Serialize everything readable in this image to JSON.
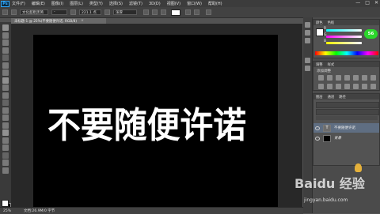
{
  "app": {
    "logo": "Ps"
  },
  "menu": {
    "items": [
      "文件(F)",
      "编辑(E)",
      "图像(I)",
      "图层(L)",
      "类型(Y)",
      "选择(S)",
      "滤镜(T)",
      "3D(D)",
      "视图(V)",
      "窗口(W)",
      "帮助(H)"
    ],
    "window_controls": [
      "—",
      "□",
      "✕"
    ]
  },
  "options": {
    "font_family": "文化超粗黑简",
    "font_style": "-",
    "font_size": "221.1 点",
    "antialias": "浑厚"
  },
  "document": {
    "tab_title": "未标题-1 @ 25%(不要随便许诺, RGB/8)",
    "close": "×",
    "canvas_text": "不要随便许诺"
  },
  "status": {
    "zoom": "25%",
    "info": "文档:26.9M/0 字节"
  },
  "color_panel": {
    "tabs": [
      "颜色",
      "色板"
    ],
    "channels": [
      "R",
      "G",
      "B"
    ],
    "values": [
      "",
      "",
      ""
    ],
    "badge": "56"
  },
  "adjustments_panel": {
    "tabs": [
      "调整",
      "样式"
    ],
    "subtitle": "添加调整"
  },
  "layers_panel": {
    "tabs": [
      "图层",
      "通道",
      "路径"
    ],
    "layers": [
      {
        "name": "不要随便许诺",
        "thumb": "T"
      },
      {
        "name": "背景",
        "thumb": ""
      }
    ]
  },
  "watermark": {
    "text": "Baidu 经验",
    "sub": "jingyan.baidu.com"
  },
  "colors": {
    "canvas": "#000000",
    "canvas_text": "#ffffff",
    "badge": "#2bd72b"
  }
}
